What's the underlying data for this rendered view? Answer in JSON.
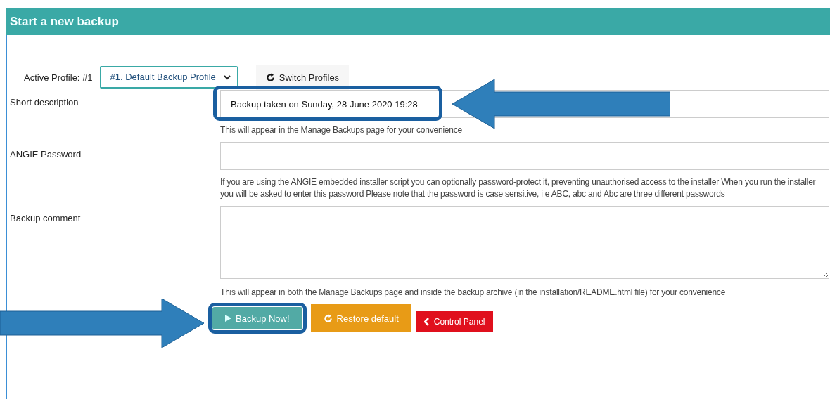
{
  "panel": {
    "title": "Start a new backup"
  },
  "profile": {
    "label": "Active Profile: #1",
    "selected_profile": "#1. Default Backup Profile",
    "switch_button": "Switch Profiles"
  },
  "fields": [
    {
      "kind": "input",
      "label": "Short description",
      "value": "Backup taken on Sunday, 28 June 2020 19:28",
      "highlighted": true,
      "help": "This will appear in the Manage Backups page for your convenience"
    },
    {
      "kind": "input",
      "label": "ANGIE Password",
      "highlighted": false,
      "help": "If you are using the ANGIE embedded installer script you can optionally password-protect it, preventing unauthorised access to the installer When you run the installer you will be asked to enter this password  Please note that the password is case sensitive, i e  ABC, abc and Abc are three different passwords"
    },
    {
      "kind": "textarea",
      "label": "Backup comment",
      "highlighted": false,
      "help": "This will appear in both the Manage Backups page and inside the backup archive (in the installation/README.html file) for your convenience"
    }
  ],
  "buttons": [
    {
      "kind": "primary",
      "label": "Backup Now!",
      "highlighted": true
    },
    {
      "kind": "warning",
      "label": "Restore default",
      "highlighted": false
    },
    {
      "kind": "danger",
      "label": "Control Panel",
      "highlighted": false
    }
  ]
}
